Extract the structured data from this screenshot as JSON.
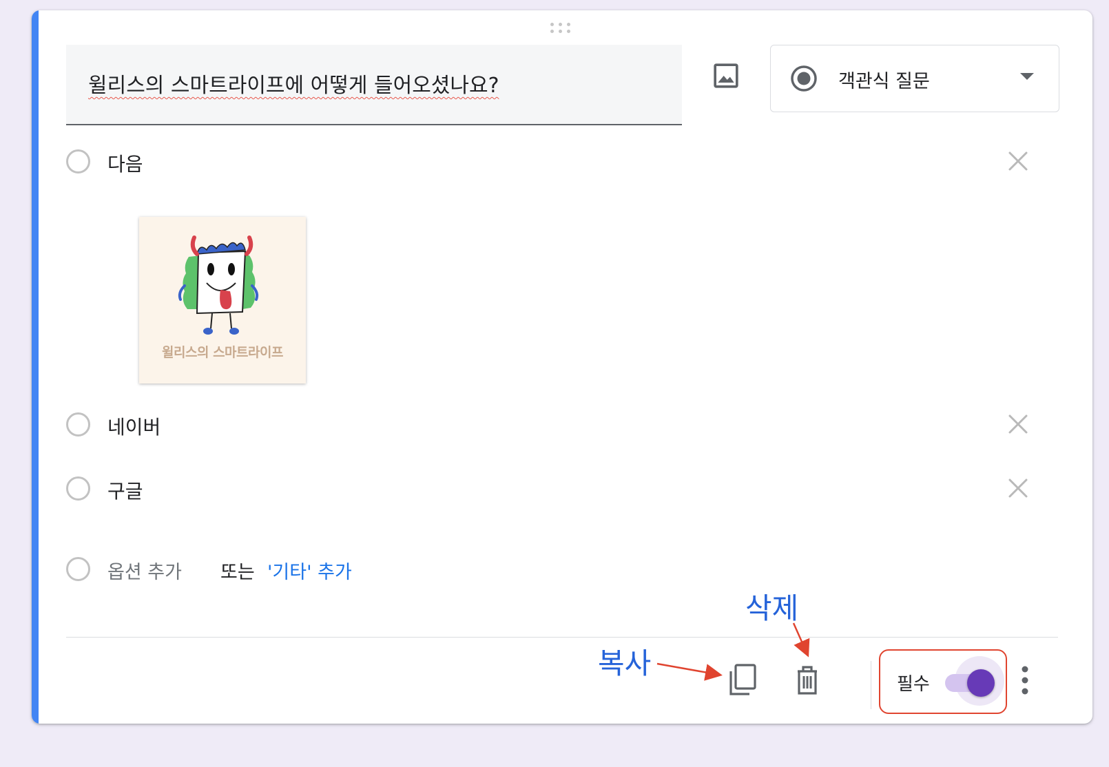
{
  "question": {
    "title": "윌리스의 스마트라이프에 어떻게 들어오셨나요?",
    "type_label": "객관식 질문"
  },
  "options": [
    {
      "label": "다음"
    },
    {
      "label": "네이버"
    },
    {
      "label": "구글"
    }
  ],
  "option_image": {
    "caption": "윌리스의 스마트라이프"
  },
  "add_row": {
    "add_option": "옵션 추가",
    "or": "또는",
    "add_other": "'기타' 추가"
  },
  "footer": {
    "required_label": "필수",
    "required_on": true
  },
  "annotations": {
    "copy": "복사",
    "delete": "삭제"
  },
  "colors": {
    "accent_bar": "#4285f4",
    "toggle": "#673ab7",
    "annotation_text": "#2563d9",
    "annotation_arrow": "#e0442f"
  }
}
